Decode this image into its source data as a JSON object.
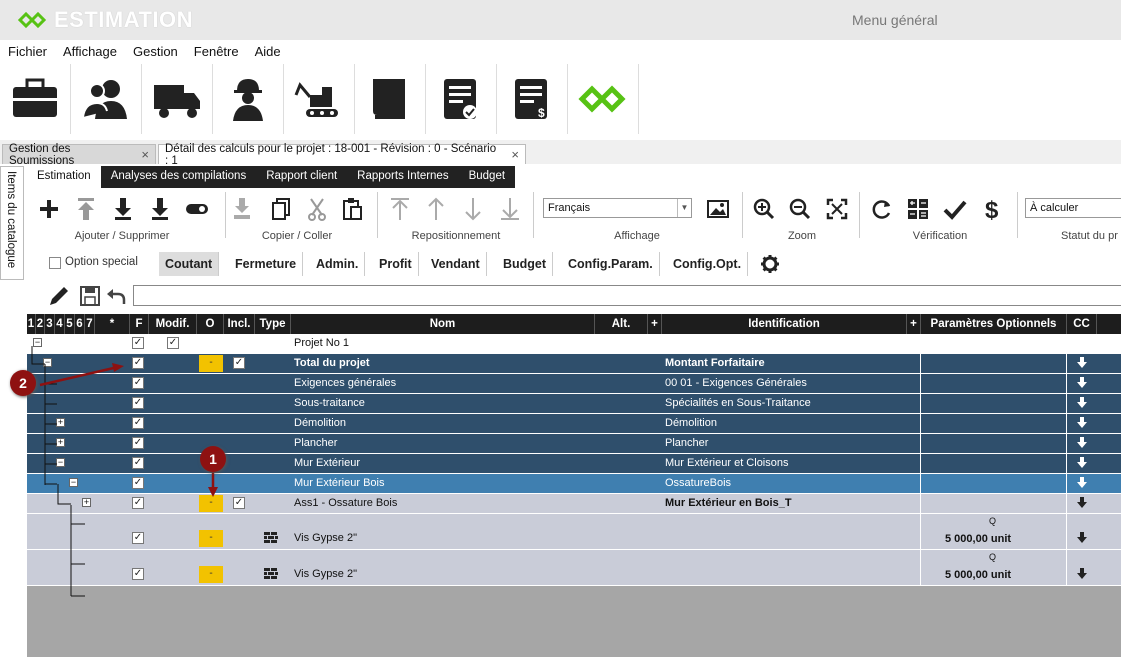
{
  "app": {
    "name": "ESTIMATION",
    "menu_general": "Menu général",
    "brand_color": "#57c214"
  },
  "menu": [
    "Fichier",
    "Affichage",
    "Gestion",
    "Fenêtre",
    "Aide"
  ],
  "toolbar": [
    "briefcase-icon",
    "contacts-icon",
    "truck-icon",
    "worker-icon",
    "excavator-icon",
    "book-icon",
    "approved-document-icon",
    "invoice-icon",
    "estimation-logo-icon"
  ],
  "doc_tabs": [
    {
      "label": "Gestion des Soumissions",
      "close": "×"
    },
    {
      "label": "Détail des calculs pour le projet : 18-001 - Révision : 0 - Scénario : 1",
      "close": "×"
    }
  ],
  "side_tab": "Items du catalogue",
  "ribbon_tabs": [
    "Estimation",
    "Analyses des compilations",
    "Rapport client",
    "Rapports Internes",
    "Budget"
  ],
  "ribbon": {
    "groups": [
      "Ajouter / Supprimer",
      "Copier / Coller",
      "Repositionnement",
      "Affichage",
      "Zoom",
      "Vérification",
      "Statut du pr"
    ],
    "language": "Français",
    "status": "À calculer"
  },
  "filter": {
    "option_special": "Option special",
    "buttons": [
      "Coutant",
      "Fermeture",
      "Admin.",
      "Profit",
      "Vendant",
      "Budget",
      "Config.Param.",
      "Config.Opt."
    ]
  },
  "grid": {
    "headers": {
      "levels": [
        "1",
        "2",
        "3",
        "4",
        "5",
        "6",
        "7"
      ],
      "star": "*",
      "f": "F",
      "modif": "Modif.",
      "o": "O",
      "incl": "Incl.",
      "type": "Type",
      "nom": "Nom",
      "alt": "Alt.",
      "plus1": "+",
      "identification": "Identification",
      "plus2": "+",
      "params": "Paramètres Optionnels",
      "cc": "CC"
    },
    "rows": [
      {
        "nom": "Projet No 1",
        "ident": "",
        "exp": "−",
        "expx": 6,
        "f": true,
        "modif": true,
        "o": false,
        "incl": false,
        "bg": "#ffffff",
        "fg": "#111",
        "bold": false,
        "h": 20
      },
      {
        "nom": "Total du projet",
        "ident": "Montant Forfaitaire",
        "exp": "−",
        "expx": 16,
        "f": true,
        "modif": false,
        "o": true,
        "o_label": "-",
        "incl": true,
        "bg": "#2f4f6c",
        "fg": "#fff",
        "bold": true,
        "h": 20
      },
      {
        "nom": "Exigences générales",
        "ident": "00 01 - Exigences Générales",
        "exp": "",
        "f": true,
        "o": false,
        "incl": false,
        "bg": "#2f4f6c",
        "fg": "#fff",
        "bold": false,
        "h": 20
      },
      {
        "nom": "Sous-traitance",
        "ident": "Spécialités en Sous-Traitance",
        "exp": "",
        "f": true,
        "o": false,
        "incl": false,
        "bg": "#2f4f6c",
        "fg": "#fff",
        "bold": false,
        "h": 20
      },
      {
        "nom": "Démolition",
        "ident": "Démolition",
        "exp": "+",
        "expx": 29,
        "f": true,
        "o": false,
        "incl": false,
        "bg": "#2f4f6c",
        "fg": "#fff",
        "bold": false,
        "h": 20
      },
      {
        "nom": "Plancher",
        "ident": "Plancher",
        "exp": "+",
        "expx": 29,
        "f": true,
        "o": false,
        "incl": false,
        "bg": "#2f4f6c",
        "fg": "#fff",
        "bold": false,
        "h": 20
      },
      {
        "nom": "Mur Extérieur",
        "ident": "Mur Extérieur et Cloisons",
        "exp": "−",
        "expx": 29,
        "f": true,
        "o": false,
        "incl": false,
        "bg": "#2f4f6c",
        "fg": "#fff",
        "bold": false,
        "h": 20
      },
      {
        "nom": "Mur Extérieur Bois",
        "ident": "OssatureBois",
        "exp": "−",
        "expx": 42,
        "f": true,
        "o": false,
        "incl": false,
        "bg": "#3f7fb0",
        "fg": "#fff",
        "bold": false,
        "h": 20
      },
      {
        "nom": "Ass1 - Ossature Bois",
        "ident": "Mur Extérieur en Bois_T",
        "exp": "+",
        "expx": 55,
        "f": true,
        "o": true,
        "o_label": "-",
        "incl": true,
        "bg": "#c9ccd8",
        "fg": "#111",
        "bold": false,
        "identbold": true,
        "h": 20
      },
      {
        "nom": "Vis Gypse 2\"",
        "ident": "",
        "exp": "",
        "f": true,
        "o": true,
        "o_label": "-",
        "incl": false,
        "type": "brick-icon",
        "param_top": "Q",
        "param": "5 000,00 unit",
        "bg": "#c9ccd8",
        "fg": "#111",
        "bold": false,
        "h": 36
      },
      {
        "nom": "Vis Gypse 2\"",
        "ident": "",
        "exp": "",
        "f": true,
        "o": true,
        "o_label": "-",
        "incl": false,
        "type": "brick-icon",
        "param_top": "Q",
        "param": "5 000,00 unit",
        "bg": "#c9ccd8",
        "fg": "#111",
        "bold": false,
        "h": 36
      }
    ]
  },
  "callouts": [
    "1",
    "2"
  ]
}
